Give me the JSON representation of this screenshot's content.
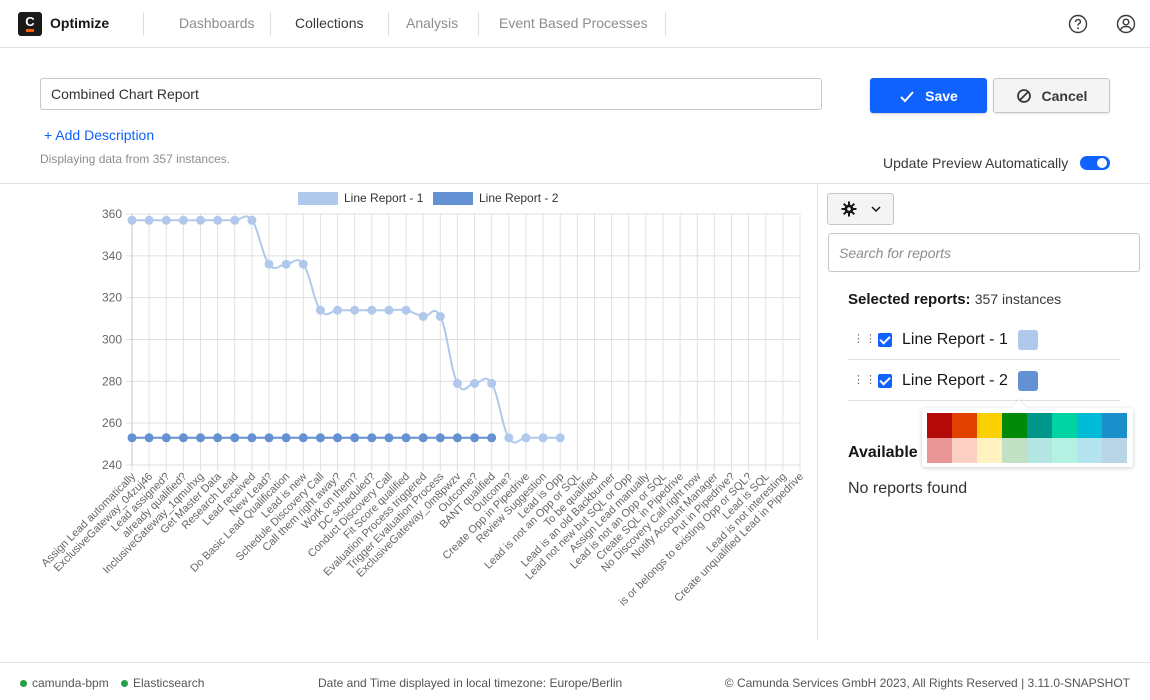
{
  "header": {
    "logo_letter": "C",
    "app_name": "Optimize",
    "nav": [
      {
        "label": "Dashboards",
        "active": false
      },
      {
        "label": "Collections",
        "active": true
      },
      {
        "label": "Analysis",
        "active": false
      },
      {
        "label": "Event Based Processes",
        "active": false
      }
    ],
    "icons": [
      "help-icon",
      "user-icon"
    ]
  },
  "report": {
    "name_value": "Combined Chart Report",
    "add_description": "+ Add Description",
    "instances_note": "Displaying data from 357 instances.",
    "save_label": "Save",
    "cancel_label": "Cancel",
    "update_preview_label": "Update Preview Automatically",
    "update_preview_on": true
  },
  "sidebar": {
    "search_placeholder": "Search for reports",
    "selected_title": "Selected reports:",
    "selected_count": "357 instances",
    "selected_reports": [
      {
        "name": "Line Report - 1",
        "checked": true,
        "color": "#b0c8eb"
      },
      {
        "name": "Line Report - 2",
        "checked": true,
        "color": "#6391d3"
      }
    ],
    "available_title": "Available",
    "no_reports": "No reports found",
    "palette": {
      "dark": [
        "#b50a0a",
        "#e04101",
        "#fccf00",
        "#008a08",
        "#00968a",
        "#00d4a5",
        "#00bbd6",
        "#1b8fc9"
      ],
      "light": [
        "#eb9696",
        "#fbcfc4",
        "#fef2c0",
        "#c1e0c4",
        "#b3e6e2",
        "#b3f1e3",
        "#b3e4ed",
        "#b8d5e6"
      ]
    }
  },
  "footer": {
    "status": [
      {
        "label": "camunda-bpm",
        "color": "#24a148"
      },
      {
        "label": "Elasticsearch",
        "color": "#24a148"
      }
    ],
    "timezone": "Date and Time displayed in local timezone: Europe/Berlin",
    "copyright": "© Camunda Services GmbH 2023, All Rights Reserved | 3.11.0-SNAPSHOT"
  },
  "chart_data": {
    "type": "line",
    "title": "",
    "xlabel": "",
    "ylabel": "",
    "ylim": [
      240,
      360
    ],
    "yticks": [
      240,
      260,
      280,
      300,
      320,
      340,
      360
    ],
    "grid": true,
    "legend_position": "top-center",
    "categories": [
      "Assign Lead automatically",
      "ExclusiveGateway_04zuj46",
      "Lead assigned?",
      "already qualified?",
      "InclusiveGateway_1qmuhxg",
      "Get Master Data",
      "Research Lead",
      "Lead received",
      "New Lead?",
      "Do Basic Lead Qualification",
      "Lead is new",
      "Schedule Discovery Call",
      "Call them right away?",
      "Work on them?",
      "DC scheduled?",
      "Conduct Discovery Call",
      "Fit Score qualified",
      "Evaluation Process triggered",
      "Trigger Evaluation Process",
      "ExclusiveGateway_0m8pwzv",
      "Outcome?",
      "BANT qualified",
      "Outcome?",
      "Create Opp in Pipedrive",
      "Review Suggestion",
      "Lead is Opp",
      "Lead is not an Opp or SQL",
      "To be qualified",
      "Lead is an old Backburner",
      "Lead not new but SQL or Opp",
      "Assign Lead manually",
      "Lead is not an Opp or SQL",
      "Create SQL in Pipedrive",
      "No Discovery Call right now",
      "Notify Account Manager",
      "Put in Pipedrive?",
      "is or belongs to existing Opp or SQL?",
      "Lead is SQL",
      "Lead is not interesting",
      "Create unqualified Lead in Pipedrive"
    ],
    "series": [
      {
        "name": "Line Report - 1",
        "color": "#b0c8eb",
        "values": [
          357,
          357,
          357,
          357,
          357,
          357,
          357,
          357,
          336,
          336,
          336,
          314,
          314,
          314,
          314,
          314,
          314,
          311,
          311,
          279,
          279,
          279,
          253,
          253,
          253,
          253
        ]
      },
      {
        "name": "Line Report - 2",
        "color": "#6391d3",
        "values": [
          253,
          253,
          253,
          253,
          253,
          253,
          253,
          253,
          253,
          253,
          253,
          253,
          253,
          253,
          253,
          253,
          253,
          253,
          253,
          253,
          253,
          253
        ]
      }
    ]
  }
}
